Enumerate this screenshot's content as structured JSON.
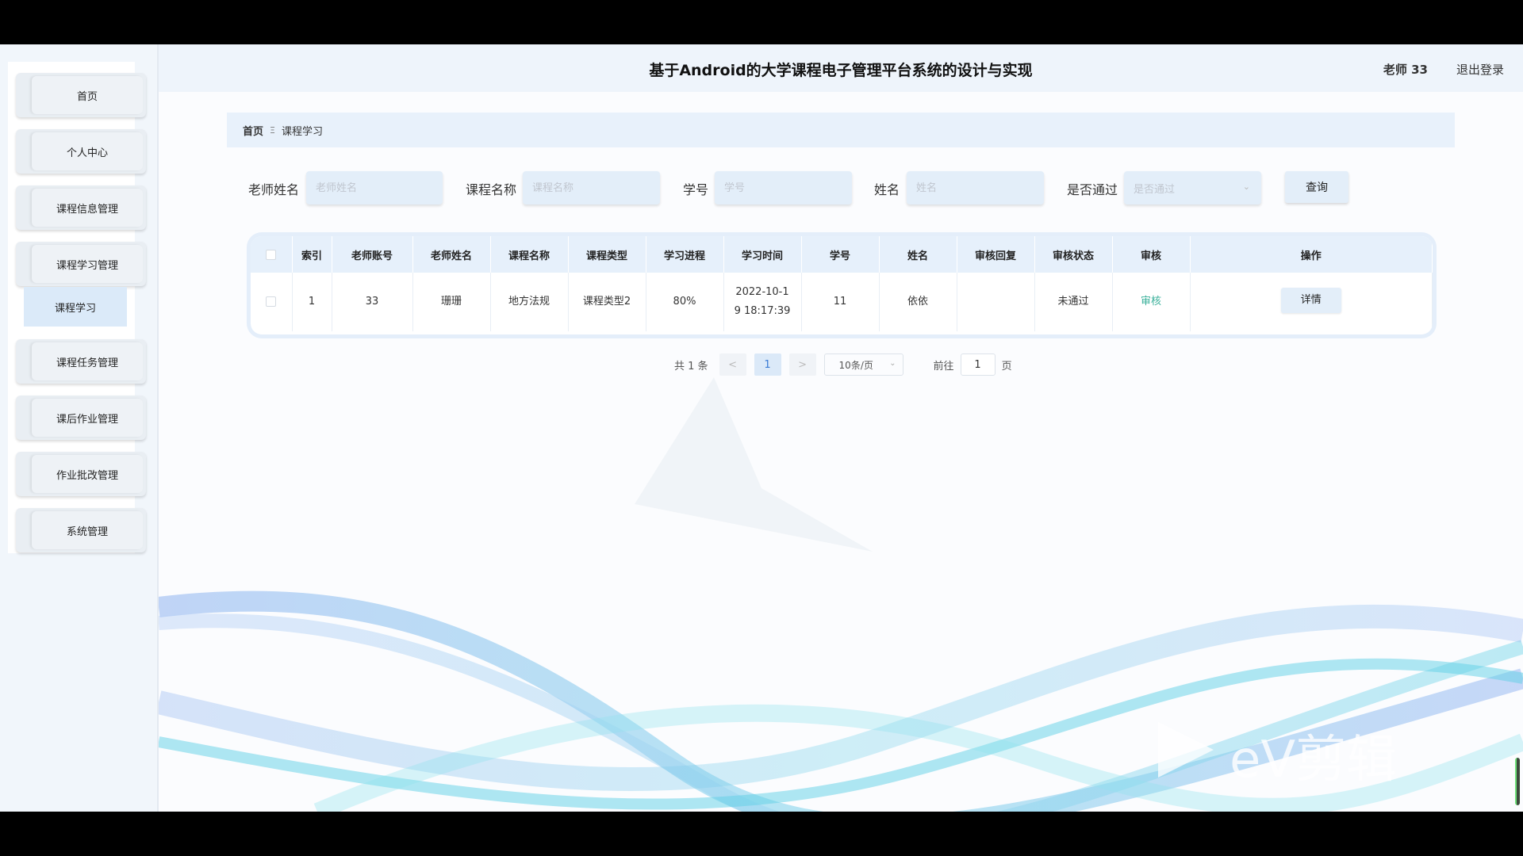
{
  "header": {
    "title": "基于Android的大学课程电子管理平台系统的设计与实现",
    "user": "老师 33",
    "logout": "退出登录"
  },
  "sidebar": {
    "items": [
      {
        "label": "首页"
      },
      {
        "label": "个人中心"
      },
      {
        "label": "课程信息管理"
      },
      {
        "label": "课程学习管理"
      },
      {
        "label": "课程任务管理"
      },
      {
        "label": "课后作业管理"
      },
      {
        "label": "作业批改管理"
      },
      {
        "label": "系统管理"
      }
    ],
    "submenu_active": "课程学习"
  },
  "breadcrumb": {
    "home": "首页",
    "separator": "Ξ",
    "current": "课程学习"
  },
  "search": {
    "teacher_name_label": "老师姓名",
    "teacher_name_placeholder": "老师姓名",
    "course_name_label": "课程名称",
    "course_name_placeholder": "课程名称",
    "student_no_label": "学号",
    "student_no_placeholder": "学号",
    "name_label": "姓名",
    "name_placeholder": "姓名",
    "passed_label": "是否通过",
    "passed_placeholder": "是否通过",
    "query_button": "查询"
  },
  "table": {
    "headers": [
      "索引",
      "老师账号",
      "老师姓名",
      "课程名称",
      "课程类型",
      "学习进程",
      "学习时间",
      "学号",
      "姓名",
      "审核回复",
      "审核状态",
      "审核",
      "操作"
    ],
    "rows": [
      {
        "index": "1",
        "teacher_account": "33",
        "teacher_name": "珊珊",
        "course_name": "地方法规",
        "course_type": "课程类型2",
        "progress": "80%",
        "study_time_line1": "2022-10-1",
        "study_time_line2": "9 18:17:39",
        "student_no": "11",
        "name": "依依",
        "audit_reply": "",
        "audit_status": "未通过",
        "audit_action": "审核",
        "detail_button": "详情"
      }
    ]
  },
  "pagination": {
    "total": "共 1 条",
    "prev": "<",
    "current_page": "1",
    "next": ">",
    "page_size": "10条/页",
    "goto_label": "前往",
    "goto_value": "1",
    "page_suffix": "页"
  },
  "watermark": {
    "text": "eV剪辑"
  },
  "colors": {
    "accent": "#3bb19b",
    "header_bg": "#eef4fb",
    "sidebar_active": "#dbeaf9"
  }
}
